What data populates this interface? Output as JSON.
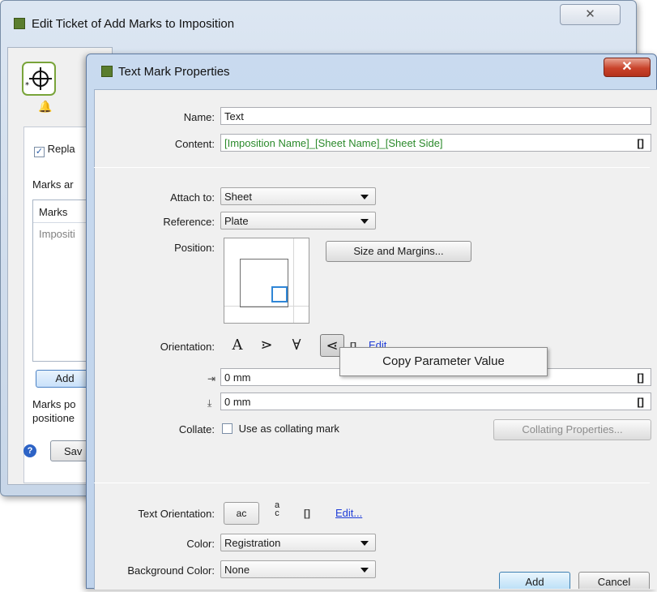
{
  "back_window": {
    "title": "Edit Ticket of Add Marks to Imposition",
    "close_glyph": "✕",
    "replace_label": "Repla",
    "marks_section_label": "Marks ar",
    "marks_header": "Marks",
    "marks_item": "Impositi",
    "add_button": "Add",
    "note_line1": "Marks po",
    "note_line2": "positione",
    "save_button": "Sav"
  },
  "dialog": {
    "title": "Text Mark Properties",
    "close_glyph": "✕",
    "name_label": "Name:",
    "name_value": "Text",
    "content_label": "Content:",
    "content_value": "[Imposition Name]_[Sheet Name]_[Sheet Side]",
    "param_bracket": "[]",
    "attach_label": "Attach to:",
    "attach_value": "Sheet",
    "reference_label": "Reference:",
    "reference_value": "Plate",
    "position_label": "Position:",
    "size_margins_button": "Size and Margins...",
    "orientation_label": "Orientation:",
    "orientation_glyphs": [
      "A",
      "⋗",
      "∀",
      "⋖"
    ],
    "orientation_edit": "Edit",
    "context_menu_item": "Copy Parameter Value",
    "offset_x_value": "0 mm",
    "offset_y_value": "0 mm",
    "collate_label": "Collate:",
    "collate_checkbox_label": "Use as collating mark",
    "collating_properties_button": "Collating Properties...",
    "text_orientation_label": "Text Orientation:",
    "text_orientation_h": "ac",
    "text_orientation_v": "a c",
    "text_orientation_edit": "Edit...",
    "color_label": "Color:",
    "color_value": "Registration",
    "bg_color_label": "Background Color:",
    "bg_color_value": "None",
    "add_button": "Add",
    "cancel_button": "Cancel"
  },
  "colors": {
    "content_text": "#2b8a2b",
    "close_button": "#c9432b",
    "link": "#1e3cd7",
    "position_marker": "#2f86d6"
  }
}
